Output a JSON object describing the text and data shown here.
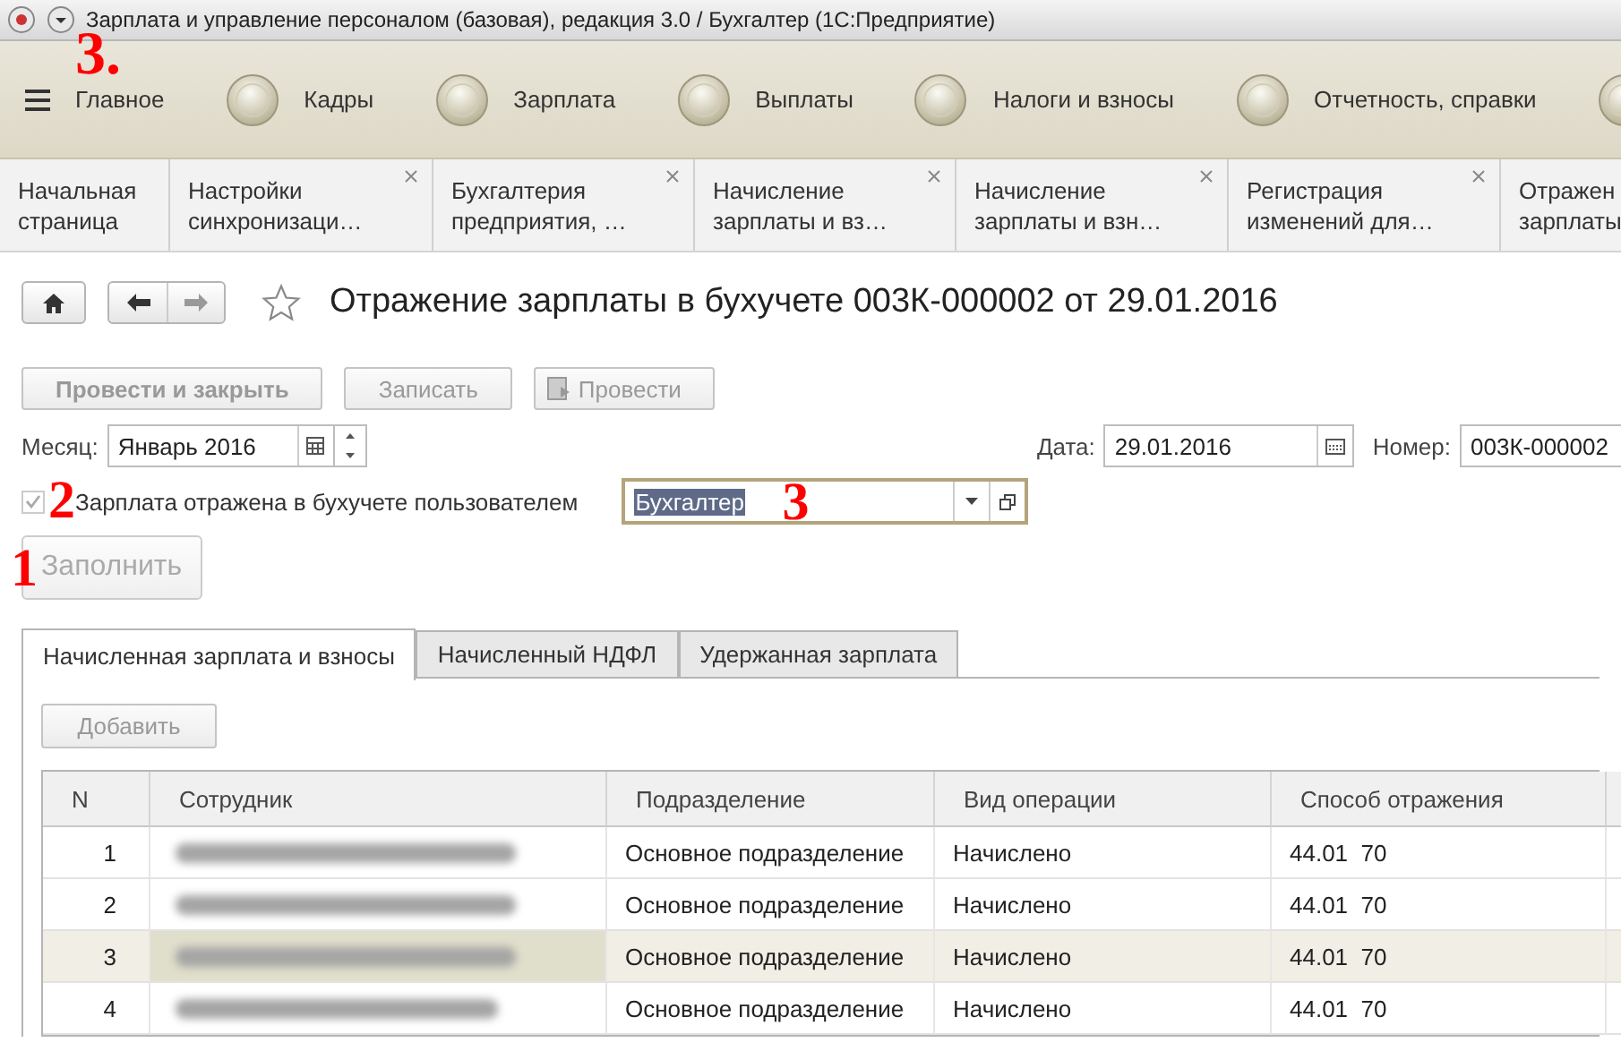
{
  "window": {
    "title": "Зарплата и управление персоналом (базовая), редакция 3.0 / Бухгалтер  (1С:Предприятие)",
    "annotation": "3."
  },
  "sections": [
    {
      "kind": "menu",
      "label": "Главное"
    },
    {
      "kind": "section",
      "label": "Кадры"
    },
    {
      "kind": "section",
      "label": "Зарплата"
    },
    {
      "kind": "section",
      "label": "Выплаты"
    },
    {
      "kind": "section",
      "label": "Налоги и взносы"
    },
    {
      "kind": "section",
      "label": "Отчетность, справки"
    },
    {
      "kind": "section"
    }
  ],
  "open_tabs": [
    {
      "lines": [
        "Начальная",
        "страница"
      ],
      "closable": false
    },
    {
      "lines": [
        "Настройки",
        "синхронизаци…"
      ],
      "closable": true
    },
    {
      "lines": [
        "Бухгалтерия",
        "предприятия, …"
      ],
      "closable": true
    },
    {
      "lines": [
        "Начисление",
        "зарплаты и вз…"
      ],
      "closable": true
    },
    {
      "lines": [
        "Начисление",
        "зарплаты и взн…"
      ],
      "closable": true
    },
    {
      "lines": [
        "Регистрация",
        "изменений для…"
      ],
      "closable": true
    },
    {
      "lines": [
        "Отражен",
        "зарплаты"
      ],
      "closable": false
    }
  ],
  "document": {
    "title": "Отражение зарплаты в бухучете 003К-000002 от 29.01.2016"
  },
  "commands": [
    {
      "kind": "default",
      "label": "Провести и закрыть",
      "disabled": true
    },
    {
      "kind": "plain",
      "label": "Записать",
      "disabled": true
    },
    {
      "kind": "icon",
      "label": "Провести",
      "disabled": true
    }
  ],
  "month": {
    "label": "Месяц:",
    "value": "Январь 2016"
  },
  "date": {
    "label": "Дата:",
    "value": "29.01.2016"
  },
  "number": {
    "label": "Номер:",
    "value": "003К-000002"
  },
  "reflected_checkbox": {
    "label": "Зарплата отражена в бухучете пользователем",
    "checked": true,
    "disabled": true,
    "annotation": "2"
  },
  "user_field": {
    "value": "Бухгалтер",
    "annotation": "3"
  },
  "fill_button": {
    "label": "Заполнить",
    "disabled": true,
    "annotation": "1"
  },
  "form_tabs": [
    {
      "label": "Начисленная зарплата и взносы",
      "selected": true
    },
    {
      "label": "Начисленный НДФЛ",
      "selected": false
    },
    {
      "label": "Удержанная зарплата",
      "selected": false
    }
  ],
  "add_button": {
    "label": "Добавить",
    "disabled": true
  },
  "table": {
    "columns": [
      "N",
      "Сотрудник",
      "Подразделение",
      "Вид операции",
      "Способ отражения"
    ],
    "rows": [
      {
        "n": "1",
        "department": "Основное подразделение",
        "operation": "Начислено",
        "method": "44.01  70",
        "selected": false
      },
      {
        "n": "2",
        "department": "Основное подразделение",
        "operation": "Начислено",
        "method": "44.01  70",
        "selected": false
      },
      {
        "n": "3",
        "department": "Основное подразделение",
        "operation": "Начислено",
        "method": "44.01  70",
        "selected": true
      },
      {
        "n": "4",
        "department": "Основное подразделение",
        "operation": "Начислено",
        "method": "44.01  70",
        "selected": false
      }
    ]
  }
}
